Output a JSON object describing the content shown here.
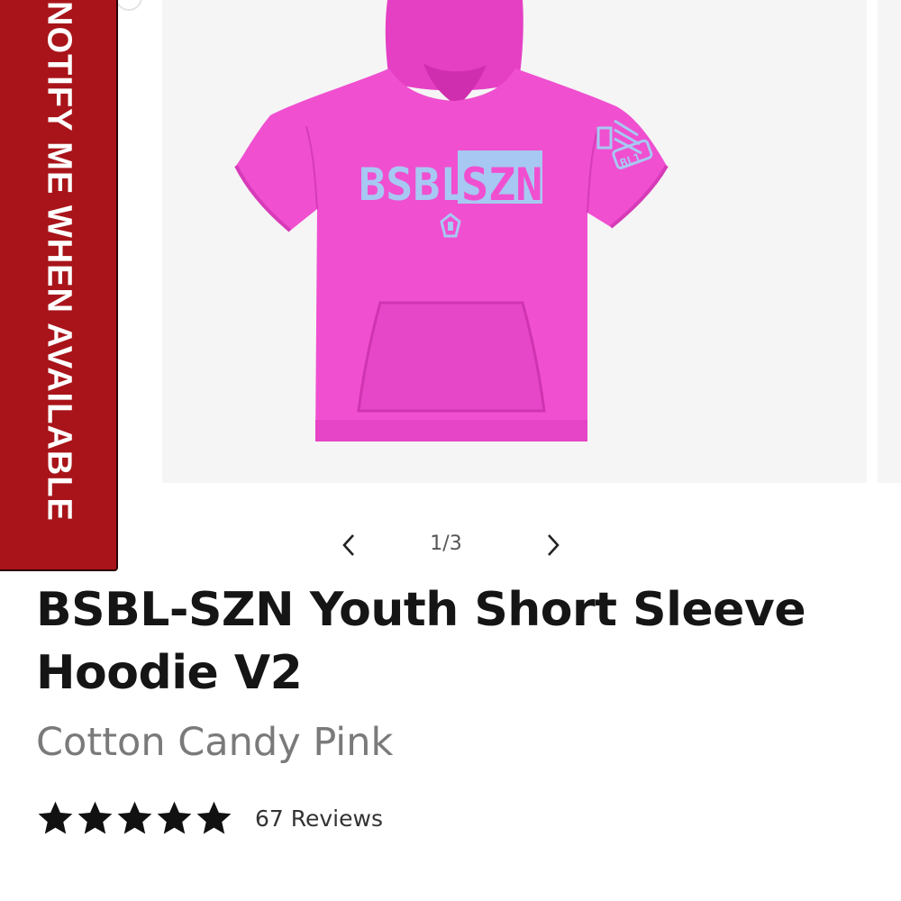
{
  "notify_button": {
    "label": "NOTIFY ME WHEN AVAILABLE"
  },
  "product_image": {
    "chest_text_left": "BSBL",
    "chest_text_right": "SZN",
    "sleeve_text": "BL1"
  },
  "pager": {
    "counter": "1/3"
  },
  "product": {
    "title": "BSBL-SZN Youth Short Sleeve Hoodie V2",
    "variant": "Cotton Candy Pink",
    "rating": 5,
    "reviews_label": "67 Reviews"
  },
  "colors": {
    "notify_bg": "#a8141a",
    "hoodie_pink": "#f04fd0",
    "print_blue": "#a7c8f2",
    "text_dark": "#151515",
    "text_muted": "#7a7a7a"
  },
  "icons": {
    "prev": "chevron-left-icon",
    "next": "chevron-right-icon",
    "star": "star-icon"
  }
}
